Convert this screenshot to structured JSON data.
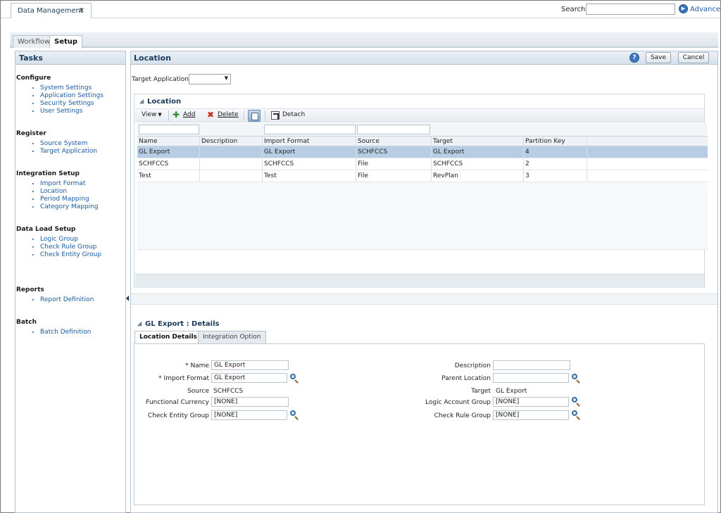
{
  "header": {
    "doc_tab_label": "Data Management",
    "doc_tab_close": "✕",
    "search_label": "Search:",
    "search_value": "",
    "advanced_label": "Advanced"
  },
  "nav_tabs": [
    {
      "label": "Workflow",
      "active": false
    },
    {
      "label": "Setup",
      "active": true
    }
  ],
  "tasks": {
    "title": "Tasks",
    "groups": [
      {
        "title": "Configure",
        "items": [
          "System Settings",
          "Application Settings",
          "Security Settings",
          "User Settings"
        ]
      },
      {
        "title": "Register",
        "items": [
          "Source System",
          "Target Application"
        ]
      },
      {
        "title": "Integration Setup",
        "items": [
          "Import Format",
          "Location",
          "Period Mapping",
          "Category Mapping"
        ]
      },
      {
        "title": "Data Load Setup",
        "items": [
          "Logic Group",
          "Check Rule Group",
          "Check Entity Group"
        ]
      },
      {
        "title": "Reports",
        "items": [
          "Report Definition"
        ]
      },
      {
        "title": "Batch",
        "items": [
          "Batch Definition"
        ]
      }
    ]
  },
  "main": {
    "title": "Location",
    "help": "?",
    "save_label": "Save",
    "cancel_label": "Cancel",
    "target_app_label": "Target Application",
    "target_app_value": ""
  },
  "location": {
    "title": "Location",
    "toolbar": {
      "view_label": "View",
      "add_label": "Add",
      "delete_label": "Delete",
      "detach_label": "Detach"
    },
    "columns": [
      "Name",
      "Description",
      "Import Format",
      "Source",
      "Target",
      "Partition Key"
    ],
    "rows": [
      {
        "name": "GL Export",
        "description": "",
        "import_format": "GL Export",
        "source": "SCHFCCS",
        "target": "GL Export",
        "partition_key": "4",
        "selected": true
      },
      {
        "name": "SCHFCCS",
        "description": "",
        "import_format": "SCHFCCS",
        "source": "File",
        "target": "SCHFCCS",
        "partition_key": "2",
        "selected": false
      },
      {
        "name": "Test",
        "description": "",
        "import_format": "Test",
        "source": "File",
        "target": "RevPlan",
        "partition_key": "3",
        "selected": false
      }
    ]
  },
  "details": {
    "title": "GL Export : Details",
    "tabs": [
      {
        "label": "Location Details",
        "active": true
      },
      {
        "label": "Integration Option",
        "active": false
      }
    ],
    "left_fields": {
      "name_label": "Name",
      "name_value": "GL Export",
      "import_format_label": "Import Format",
      "import_format_value": "GL Export",
      "source_label": "Source",
      "source_value": "SCHFCCS",
      "functional_currency_label": "Functional Currency",
      "functional_currency_value": "[NONE]",
      "check_entity_group_label": "Check Entity Group",
      "check_entity_group_value": "[NONE]"
    },
    "right_fields": {
      "description_label": "Description",
      "description_value": "",
      "parent_location_label": "Parent Location",
      "parent_location_value": "",
      "target_label": "Target",
      "target_value": "GL Export",
      "logic_account_group_label": "Logic Account Group",
      "logic_account_group_value": "[NONE]",
      "check_rule_group_label": "Check Rule Group",
      "check_rule_group_value": "[NONE]"
    },
    "required_marker": "*"
  },
  "colors": {
    "header_text": "#1a3b5c",
    "link": "#1a5aa0",
    "selected_row": "#b7cde4",
    "add_icon": "#2e8a2e",
    "delete_icon": "#cc2b14"
  }
}
